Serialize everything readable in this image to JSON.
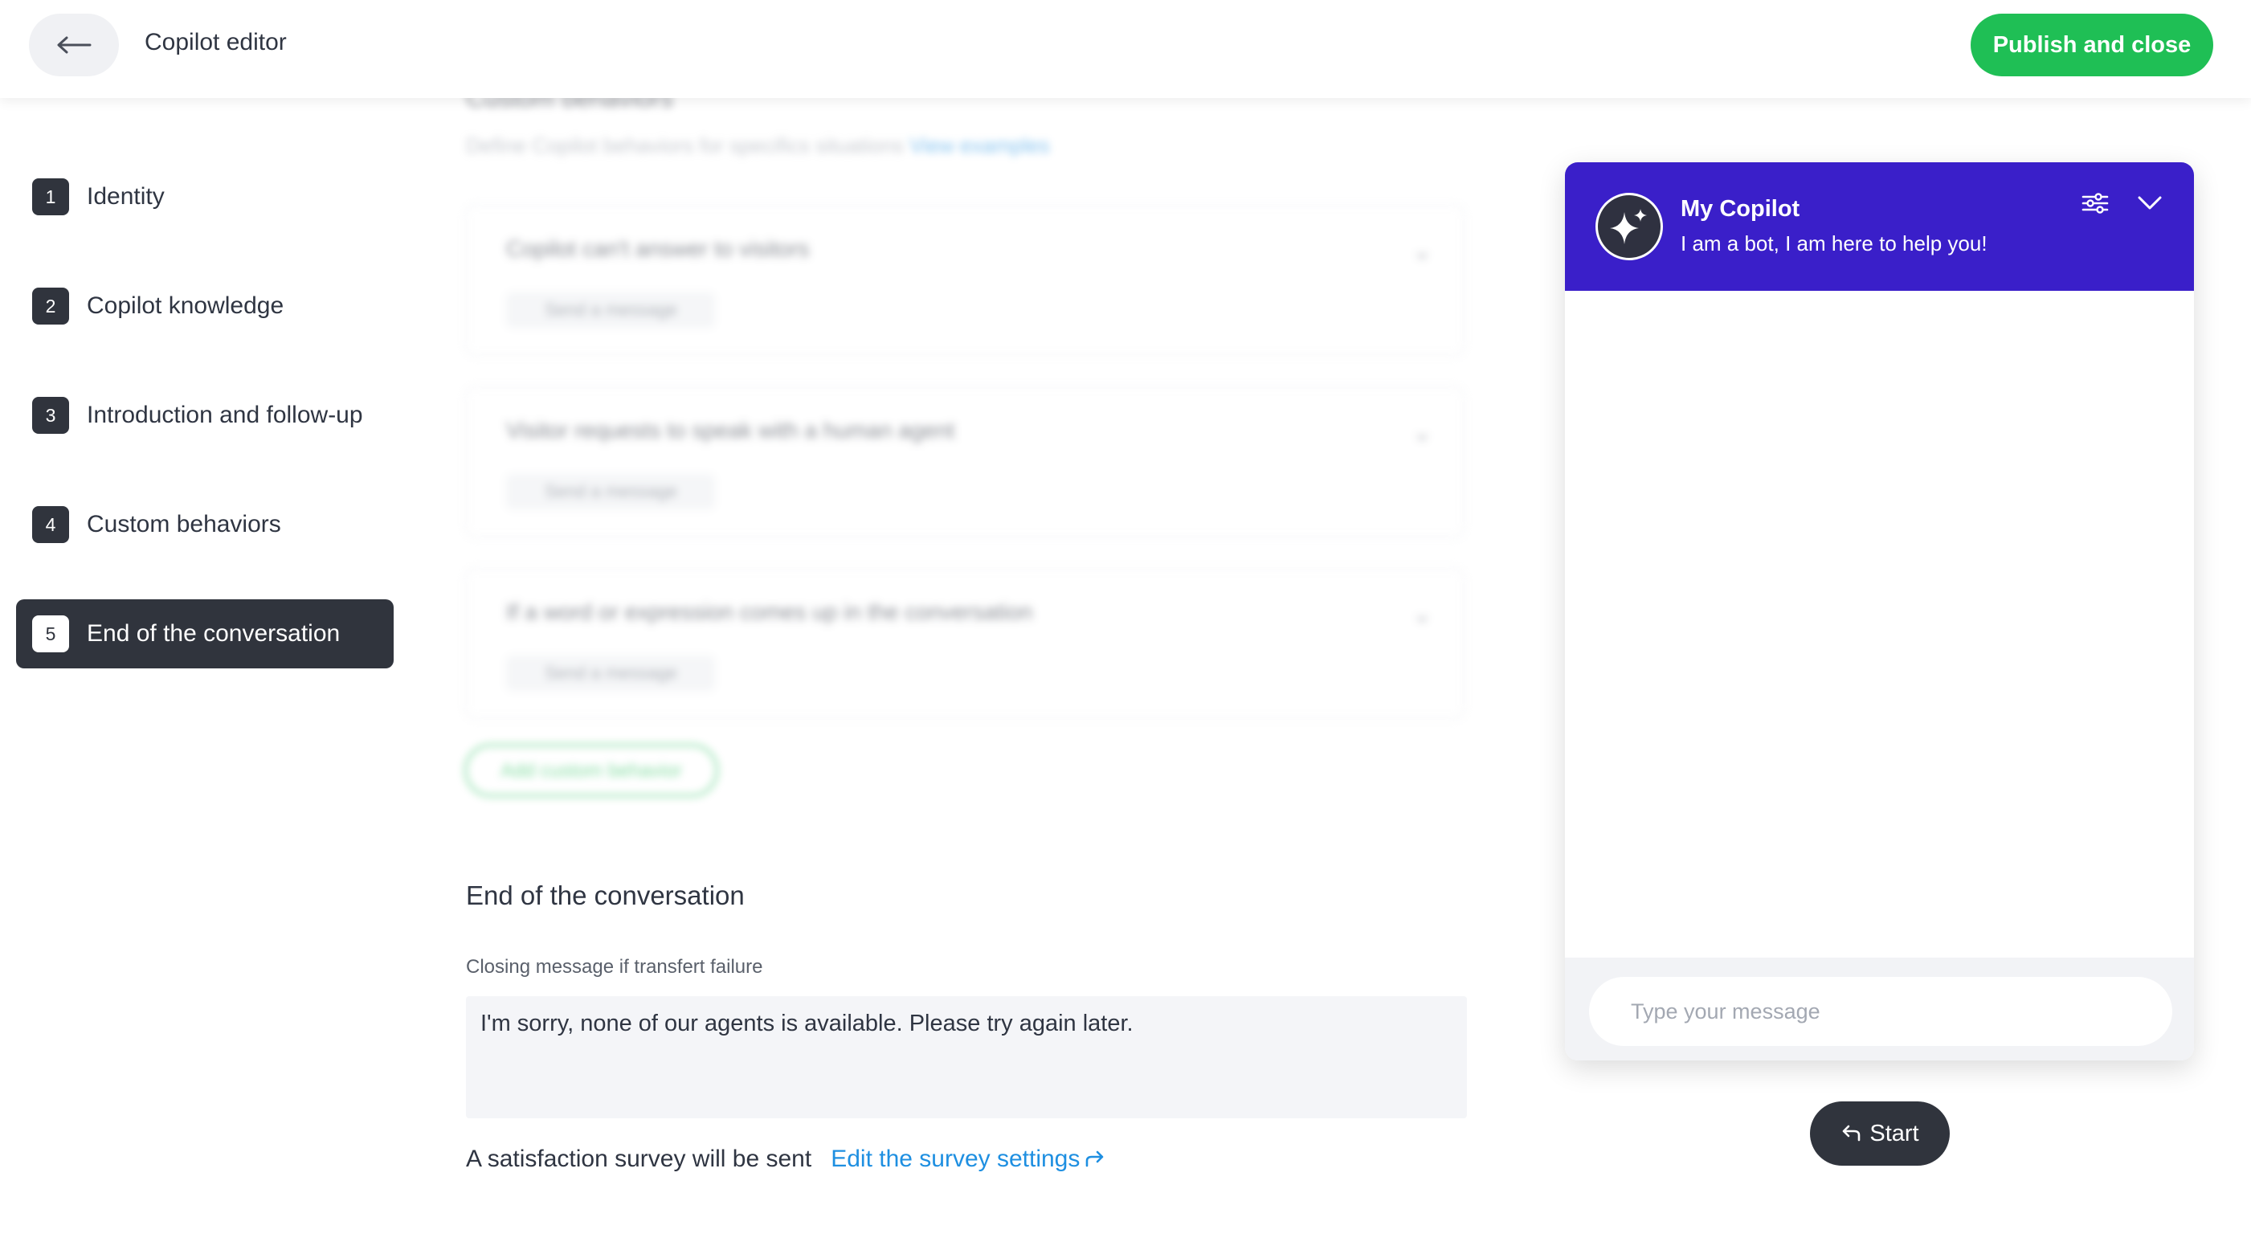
{
  "header": {
    "back_icon": "arrow-left-icon",
    "title": "Copilot editor",
    "publish_label": "Publish and close"
  },
  "sidebar": {
    "steps": [
      {
        "number": "1",
        "label": "Identity"
      },
      {
        "number": "2",
        "label": "Copilot knowledge"
      },
      {
        "number": "3",
        "label": "Introduction and follow-up"
      },
      {
        "number": "4",
        "label": "Custom behaviors"
      },
      {
        "number": "5",
        "label": "End of the conversation",
        "active": true
      }
    ]
  },
  "custom_behaviors": {
    "heading": "Custom behaviors",
    "description": "Define Copilot behaviors for specifics situations",
    "examples_link": "View examples",
    "cards": [
      {
        "title": "Copilot can't answer to visitors",
        "action": "Send a message"
      },
      {
        "title": "Visitor requests to speak with a human agent",
        "action": "Send a message"
      },
      {
        "title": "If a word or expression comes up in the conversation",
        "action": "Send a message"
      }
    ],
    "add_label": "Add custom behavior"
  },
  "end_conversation": {
    "title": "End of the conversation",
    "closing_label": "Closing message if transfert failure",
    "closing_value": "I'm sorry, none of our agents is available. Please try again later.",
    "survey_text": "A satisfaction survey will be sent",
    "survey_link": "Edit the survey settings"
  },
  "chat_preview": {
    "bot_name": "My Copilot",
    "tagline": "I am a bot, I am here to help you!",
    "input_placeholder": "Type your message",
    "start_label": "Start",
    "header_color": "#3a1fc9"
  },
  "colors": {
    "accent_green": "#1fbf55",
    "link_blue": "#1e8fe1",
    "dark": "#30343d"
  }
}
